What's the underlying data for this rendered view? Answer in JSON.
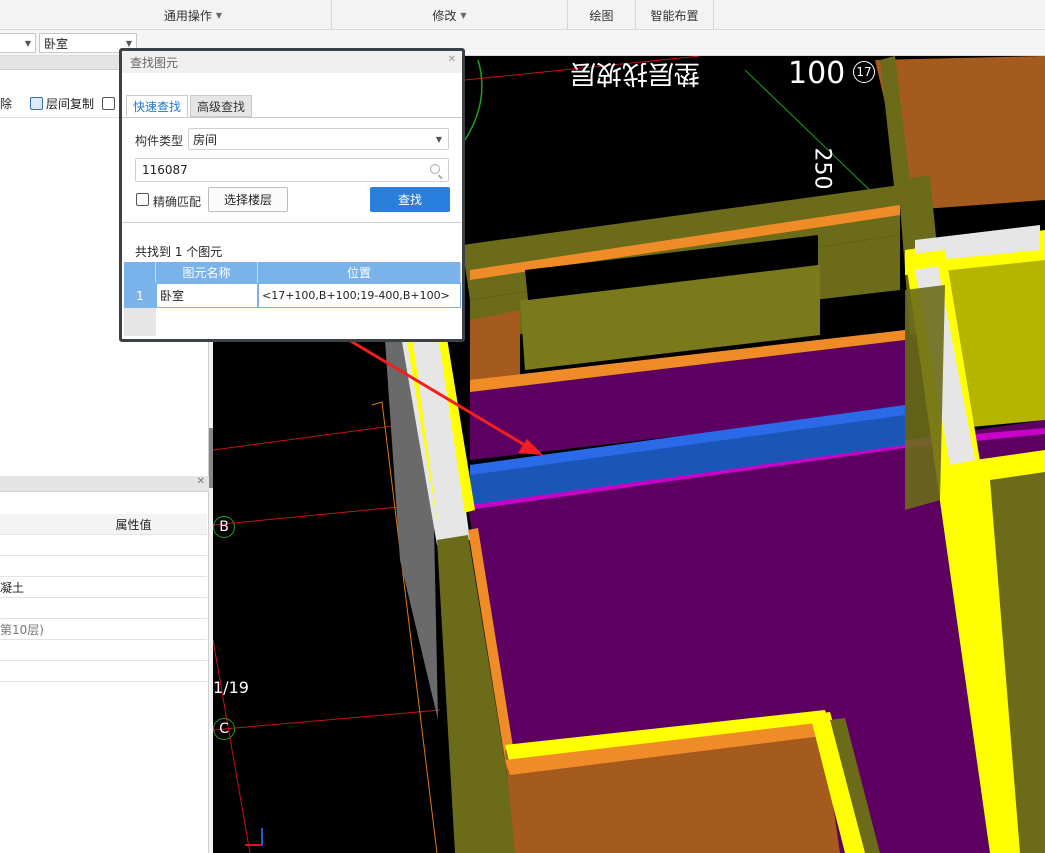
{
  "ribbon": {
    "groups": [
      "通用操作",
      "修改",
      "绘图",
      "智能布置"
    ]
  },
  "toolbar": {
    "floor_combo": "卧室"
  },
  "left_panel": {
    "tools": [
      "除",
      "层间复制"
    ],
    "prop_header": "属性值",
    "prop_values": [
      "",
      "",
      "凝土",
      "",
      "第10层)",
      "",
      ""
    ]
  },
  "canvas": {
    "grid_labels": [
      "B",
      "C"
    ],
    "axis_text": "1/19",
    "dim_top": "100",
    "dim_side": "250",
    "axis_num": "17"
  },
  "dialog": {
    "title": "查找图元",
    "tabs": [
      "快速查找",
      "高级查找"
    ],
    "type_label": "构件类型",
    "type_value": "房间",
    "search_value": "116087",
    "exact_label": "精确匹配",
    "floor_button": "选择楼层",
    "find_button": "查找",
    "result_text": "共找到 1 个图元",
    "columns": [
      "图元名称",
      "位置"
    ],
    "rows": [
      {
        "index": "1",
        "name": "卧室",
        "position": "<17+100,B+100;19-400,B+100>"
      }
    ]
  },
  "colors": {
    "accent": "#2b7fdc",
    "table_header": "#7ab3ea",
    "room_purple": "#5e0062",
    "beam_olive": "#6b6b19",
    "wall_orange": "#a55a1e"
  }
}
